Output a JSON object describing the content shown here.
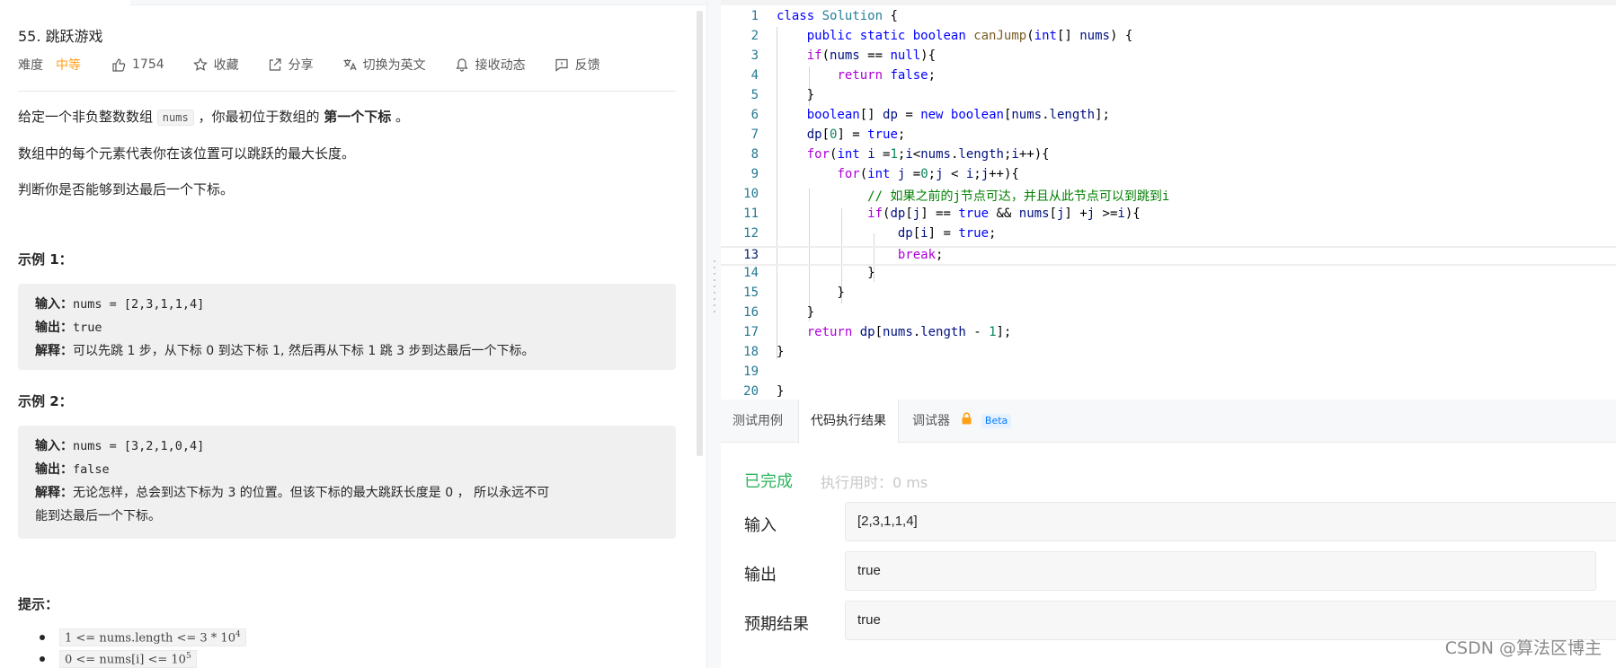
{
  "problem": {
    "title": "55. 跳跃游戏",
    "difficulty_label": "难度",
    "difficulty_value": "中等",
    "likes": "1754",
    "favorite": "收藏",
    "share": "分享",
    "switch_lang": "切换为英文",
    "notify": "接收动态",
    "feedback": "反馈"
  },
  "description": {
    "p1_a": "给定一个非负整数数组 ",
    "p1_code": "nums",
    "p1_b": " ，你最初位于数组的 ",
    "p1_bold": "第一个下标",
    "p1_c": " 。",
    "p2": "数组中的每个元素代表你在该位置可以跳跃的最大长度。",
    "p3": "判断你是否能够到达最后一个下标。"
  },
  "examples": [
    {
      "title": "示例 1：",
      "input_label": "输入：",
      "input_value": "nums = [2,3,1,1,4]",
      "output_label": "输出：",
      "output_value": "true",
      "explain_label": "解释：",
      "explain_text": "可以先跳 1 步，从下标 0 到达下标 1, 然后再从下标 1 跳 3 步到达最后一个下标。"
    },
    {
      "title": "示例 2：",
      "input_label": "输入：",
      "input_value": "nums = [3,2,1,0,4]",
      "output_label": "输出：",
      "output_value": "false",
      "explain_label": "解释：",
      "explain_text": "无论怎样，总会到达下标为 3 的位置。但该下标的最大跳跃长度是 0 ， 所以永远不可",
      "explain_text2": "能到达最后一个下标。"
    }
  ],
  "hints": {
    "title": "提示：",
    "c1": "1 <= nums.length <= 3 * 10",
    "c1_sup": "4",
    "c2": "0 <= nums[i] <= 10",
    "c2_sup": "5"
  },
  "code": {
    "line_numbers": [
      "1",
      "2",
      "3",
      "4",
      "5",
      "6",
      "7",
      "8",
      "9",
      "10",
      "11",
      "12",
      "13",
      "14",
      "15",
      "16",
      "17",
      "18",
      "19",
      "20"
    ]
  },
  "results": {
    "tabs": [
      "测试用例",
      "代码执行结果",
      "调试器"
    ],
    "beta": "Beta",
    "status": "已完成",
    "exec_time": "执行用时：0 ms",
    "input_label": "输入",
    "input_value": "[2,3,1,1,4]",
    "output_label": "输出",
    "output_value": "true",
    "expected_label": "预期结果",
    "expected_value": "true"
  },
  "watermark": "CSDN @算法区博主",
  "colors": {
    "difficulty_medium": "#ffa116",
    "status_success": "#2db55d",
    "keyword": "#0000ff",
    "control": "#af00db",
    "comment": "#008000",
    "type": "#267f99",
    "line_number": "#237893"
  }
}
